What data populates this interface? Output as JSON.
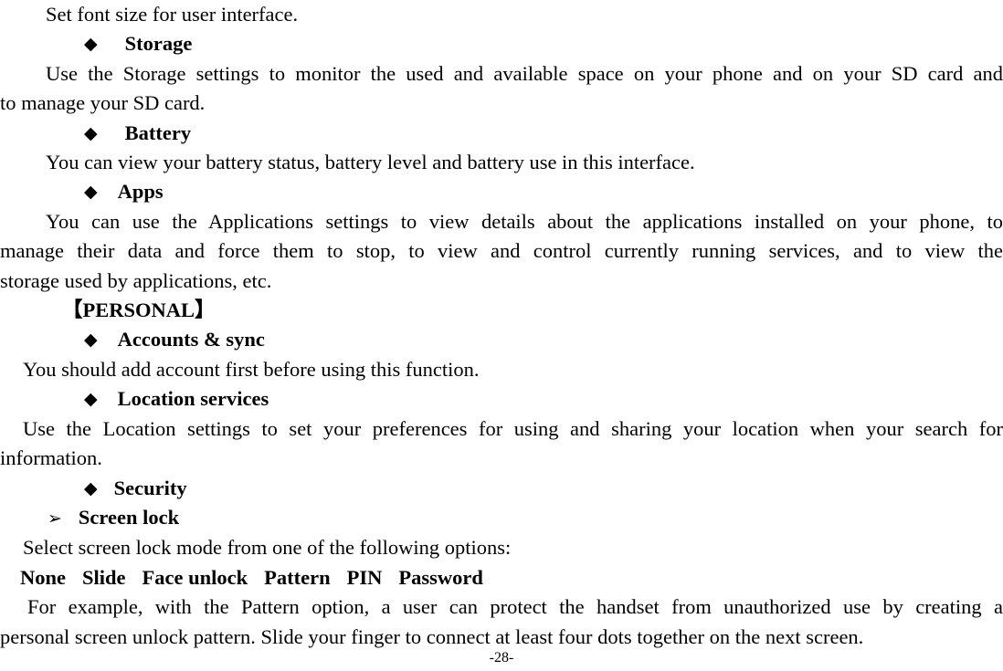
{
  "document": {
    "page_number": "-28-",
    "bullet_diamond": "◆",
    "bullet_arrow": "➢"
  },
  "blocks": {
    "font_size_line": "Set font size for user interface.",
    "storage_heading": "Storage",
    "storage_body": "Use the Storage settings to monitor the used and available space on your phone and on your SD card and to manage your SD card.",
    "storage_body_line1": "Use the Storage settings to monitor the used and available space on your phone and on your SD card and",
    "storage_body_line2": "to manage your SD card.",
    "battery_heading": "Battery",
    "battery_body": "You can view your battery status, battery level and battery use in this interface.",
    "apps_heading": "Apps",
    "apps_body_line1": "You can use the Applications settings to view details about the applications installed on your phone, to",
    "apps_body_line2": "manage their data and force them to stop, to view and control currently running services, and to view the",
    "apps_body_line3": "storage used by applications, etc.",
    "personal_section": "【PERSONAL】",
    "accounts_heading": "Accounts & sync",
    "accounts_body": "You should add account first before using this function.",
    "location_heading": "Location services",
    "location_body_line1": "Use the Location settings to set your preferences for using and sharing your location when your search for",
    "location_body_line2": "information.",
    "security_heading": "Security",
    "screen_lock_heading": "Screen lock",
    "screen_lock_body": "Select screen lock mode from one of the following options:",
    "screen_lock_options": [
      "None",
      "Slide",
      "Face unlock",
      "Pattern",
      "PIN",
      "Password"
    ],
    "pattern_example_line1": "For example, with the Pattern option, a user can protect the handset from unauthorized use by creating a",
    "pattern_example_line2": "personal screen unlock pattern. Slide your finger to connect at least four dots together on the next screen."
  }
}
